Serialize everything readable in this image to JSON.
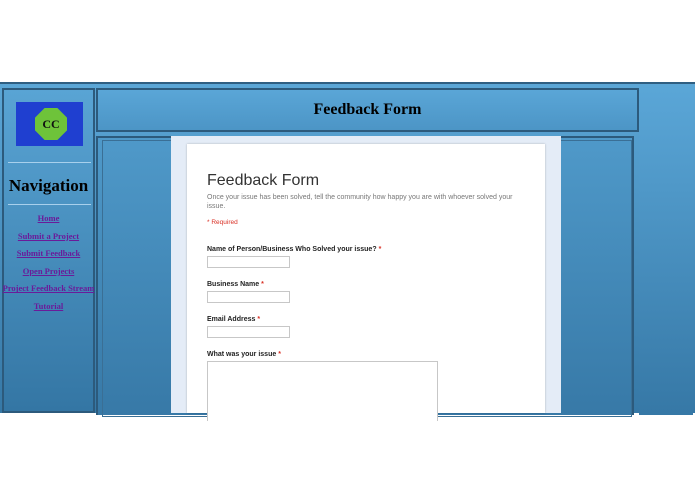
{
  "logo": {
    "text": "CC",
    "bg_color": "#1f3fd0",
    "hex_color": "#6ec33a"
  },
  "navigation": {
    "title": "Navigation",
    "links": [
      "Home",
      "Submit a Project",
      "Submit Feedback",
      "Open Projects",
      "Project Feedback Stream",
      "Tutorial"
    ]
  },
  "header": {
    "title": "Feedback Form"
  },
  "form": {
    "title": "Feedback Form",
    "description": "Once your issue has been solved, tell the community how happy you are with whoever solved your issue.",
    "required_note": "* Required",
    "questions": [
      {
        "label": "Name of Person/Business Who Solved your issue?",
        "star": "*",
        "value": ""
      },
      {
        "label": "Business Name",
        "star": "*",
        "value": ""
      },
      {
        "label": "Email Address",
        "star": "*",
        "value": ""
      },
      {
        "label": "What was your issue",
        "star": "*",
        "value": ""
      }
    ]
  },
  "colors": {
    "page_blue": "#4f99c9",
    "link_purple": "#6a1b9a",
    "required_red": "#d93025"
  }
}
